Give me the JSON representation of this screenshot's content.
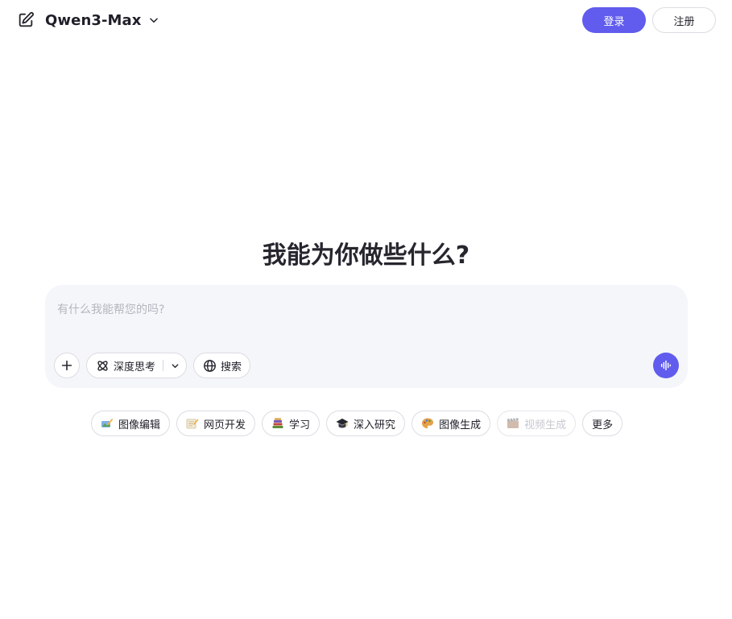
{
  "header": {
    "model_name": "Qwen3-Max",
    "login_label": "登录",
    "register_label": "注册"
  },
  "main": {
    "headline": "我能为你做些什么?"
  },
  "input": {
    "placeholder": "有什么我能帮您的吗?",
    "value": ""
  },
  "toolbar": {
    "deep_think_label": "深度思考",
    "search_label": "搜索"
  },
  "suggestions": [
    {
      "label": "图像编辑",
      "icon": "image-edit-icon",
      "enabled": true
    },
    {
      "label": "网页开发",
      "icon": "web-dev-icon",
      "enabled": true
    },
    {
      "label": "学习",
      "icon": "books-icon",
      "enabled": true
    },
    {
      "label": "深入研究",
      "icon": "graduation-cap-icon",
      "enabled": true
    },
    {
      "label": "图像生成",
      "icon": "palette-icon",
      "enabled": true
    },
    {
      "label": "视频生成",
      "icon": "video-gen-icon",
      "enabled": false
    },
    {
      "label": "更多",
      "icon": "",
      "enabled": true
    }
  ],
  "colors": {
    "accent": "#615ced",
    "input_background": "#f5f6fa",
    "border": "#dcdce3"
  }
}
